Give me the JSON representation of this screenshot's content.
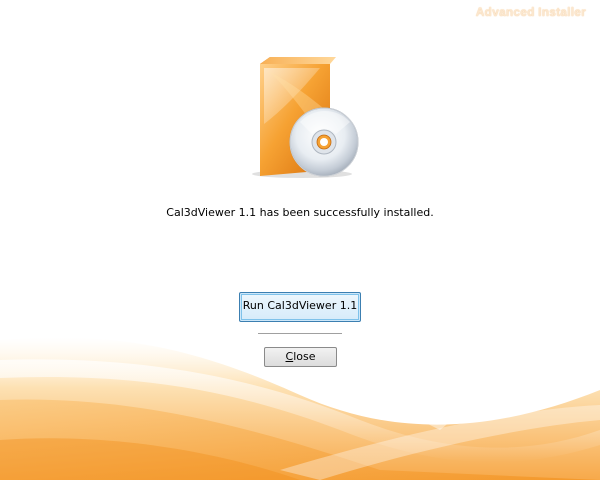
{
  "branding": {
    "text": "Advanced Installer"
  },
  "product_image": {
    "icon": "software-box-with-cd-icon"
  },
  "message": {
    "text": "Cal3dViewer 1.1 has been successfully installed."
  },
  "actions": {
    "run_label": "Run Cal3dViewer 1.1",
    "close_label_mnemonic": "C",
    "close_label_rest": "lose"
  },
  "colors": {
    "accent_orange": "#f39c21",
    "swoosh_light": "#fde3b8",
    "focus_border": "#3c7fb1"
  }
}
